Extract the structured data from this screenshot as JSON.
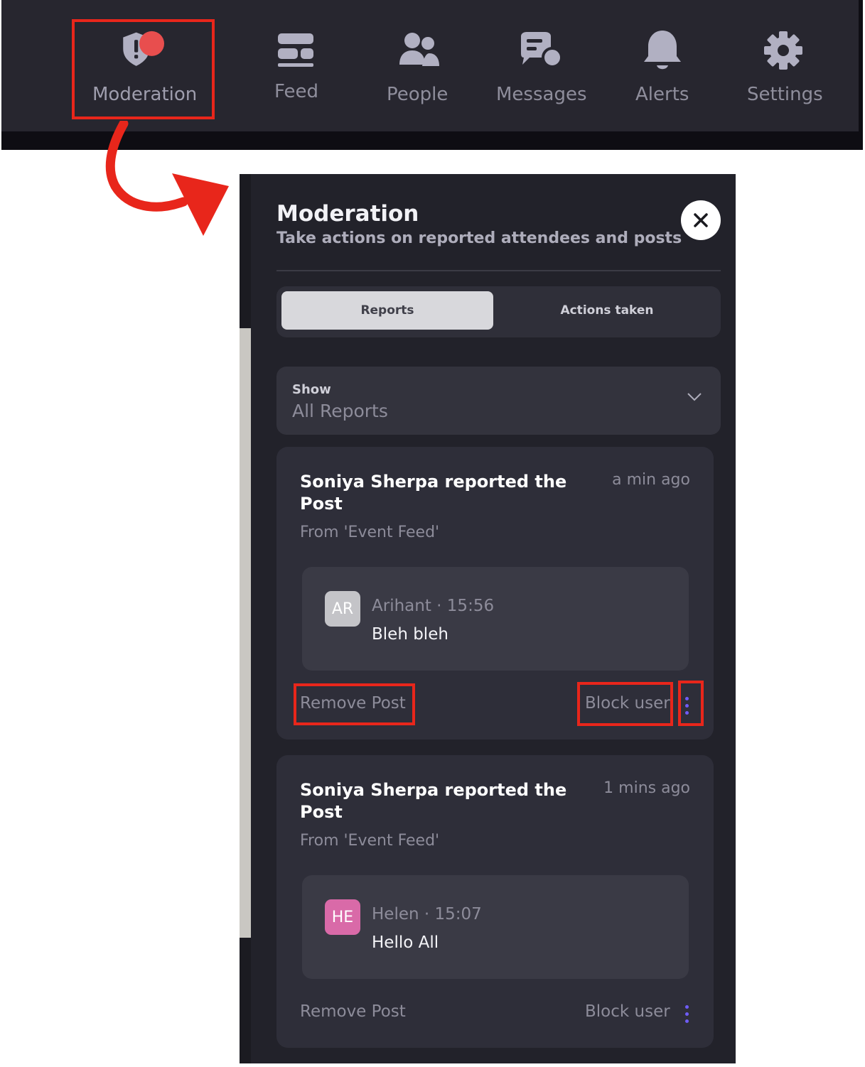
{
  "nav": {
    "items": [
      {
        "label": "Moderation",
        "icon": "shield-alert-icon"
      },
      {
        "label": "Feed",
        "icon": "feed-icon"
      },
      {
        "label": "People",
        "icon": "people-icon"
      },
      {
        "label": "Messages",
        "icon": "messages-icon"
      },
      {
        "label": "Alerts",
        "icon": "bell-icon"
      },
      {
        "label": "Settings",
        "icon": "gear-icon"
      }
    ]
  },
  "panel": {
    "title": "Moderation",
    "subtitle": "Take actions on reported attendees and posts",
    "tabs": [
      {
        "label": "Reports",
        "active": true
      },
      {
        "label": "Actions taken",
        "active": false
      }
    ],
    "filter": {
      "label": "Show",
      "value": "All Reports"
    },
    "reports": [
      {
        "title": "Soniya Sherpa reported the Post",
        "time": "a min ago",
        "source": "From 'Event Feed'",
        "post": {
          "initials": "AR",
          "author": "Arihant",
          "time": "15:56",
          "text": "Bleh bleh",
          "avatar_color": "#c4c4c8"
        },
        "actions": {
          "remove": "Remove Post",
          "block": "Block user"
        }
      },
      {
        "title": "Soniya Sherpa reported the Post",
        "time": "1 mins ago",
        "source": "From 'Event Feed'",
        "post": {
          "initials": "HE",
          "author": "Helen",
          "time": "15:07",
          "text": "Hello All",
          "avatar_color": "#d96aa8"
        },
        "actions": {
          "remove": "Remove Post",
          "block": "Block user"
        }
      }
    ]
  },
  "colors": {
    "highlight": "#e8261b",
    "notification_dot": "#e84e4e",
    "kebab_accent": "#6e5cf6",
    "nav_icon": "#b1b0c2"
  }
}
